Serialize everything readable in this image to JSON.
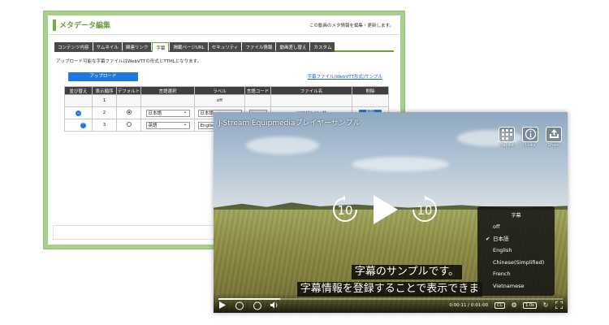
{
  "admin": {
    "title": "メタデータ編集",
    "note": "この動画のメタ情報を編集・更新します。",
    "tabs": [
      "コンテンツ内容",
      "サムネイル",
      "関連リンク",
      "字幕",
      "掲載ページURL",
      "セキュリティ",
      "ファイル情報",
      "動画差し替え",
      "カスタム"
    ],
    "active_tab": "字幕",
    "description": "アップロード可能な字幕ファイルはWebVTTの形式とTTMLとなります。",
    "upload_label": "アップロード",
    "sample_link": "字幕ファイル(WebVTT形式)サンプル",
    "table": {
      "headers": [
        "並び替え",
        "表示順序",
        "デフォルト",
        "言語選択",
        "ラベル",
        "言語コード",
        "ファイル名",
        "削除"
      ],
      "rows": [
        {
          "order": "1",
          "language": "",
          "label": "off",
          "code": "",
          "file": "",
          "default": false,
          "delete": ""
        },
        {
          "order": "2",
          "language": "日本語",
          "label": "日本語",
          "code": "ja",
          "file": "sample.cc.vtt",
          "default": true,
          "delete": "削除"
        },
        {
          "order": "3",
          "language": "英語",
          "label": "English",
          "code": "",
          "file": "",
          "default": false,
          "delete": ""
        }
      ]
    }
  },
  "player": {
    "title": "J-Stream Equipmediaプレイヤーサンプル",
    "top_icons": [
      "Playlist",
      "Links",
      "Share"
    ],
    "skip_back": "10",
    "skip_forward": "10",
    "subtitle_line1": "字幕のサンプルです。",
    "subtitle_line2": "字幕情報を登録することで表示できま",
    "menu_title": "字幕",
    "menu_items": [
      "off",
      "日本語",
      "English",
      "Chinese(Simplified)",
      "French",
      "Vietnamese"
    ],
    "menu_selected": "日本語",
    "time": "0:00:11 / 0:01:00",
    "cc_label": "CC",
    "speed_label": "1.0x",
    "progress": 0.18,
    "bar_skip_back": "10",
    "bar_skip_forward": "10"
  }
}
